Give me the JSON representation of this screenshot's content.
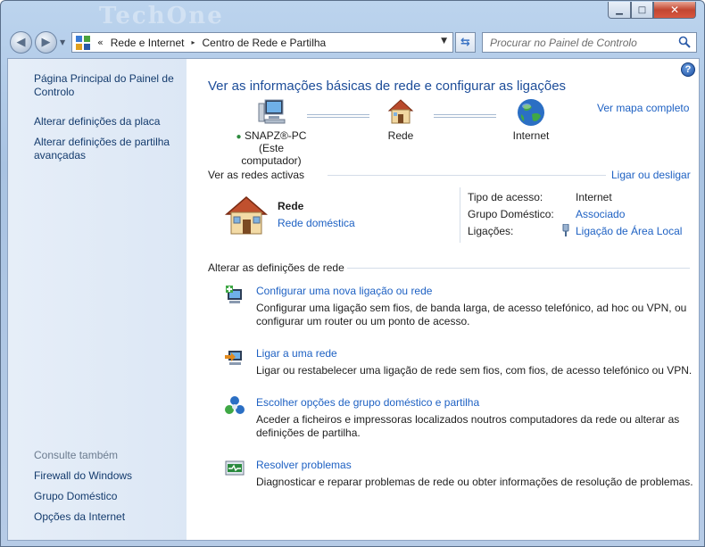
{
  "window": {
    "watermark": "TechOne",
    "controls": {
      "minimize": "▁",
      "maximize": "□",
      "close": "✕"
    }
  },
  "navbar": {
    "back_glyph": "◀",
    "forward_glyph": "▶",
    "chevron": "«",
    "breadcrumbs": [
      "Rede e Internet",
      "Centro de Rede e Partilha"
    ],
    "breadcrumb_separator": "▸",
    "search_placeholder": "Procurar no Painel de Controlo"
  },
  "sidebar": {
    "items": [
      {
        "label": "Página Principal do Painel de Controlo"
      },
      {
        "label": "Alterar definições da placa"
      },
      {
        "label": "Alterar definições de partilha avançadas"
      }
    ],
    "see_also_heading": "Consulte também",
    "see_also": [
      {
        "label": "Firewall do Windows"
      },
      {
        "label": "Grupo Doméstico"
      },
      {
        "label": "Opções da Internet"
      }
    ]
  },
  "main": {
    "help": "?",
    "title": "Ver as informações básicas de rede e configurar as ligações",
    "map_link": "Ver mapa completo",
    "network_map": {
      "computer_name": "SNAPZ®-PC",
      "computer_sub": "(Este computador)",
      "network": "Rede",
      "internet": "Internet"
    },
    "active_networks": {
      "heading": "Ver as redes activas",
      "action_link": "Ligar ou desligar",
      "name": "Rede",
      "type_link": "Rede doméstica",
      "properties": [
        {
          "label": "Tipo de acesso:",
          "value": "Internet",
          "is_link": false
        },
        {
          "label": "Grupo Doméstico:",
          "value": "Associado",
          "is_link": true
        },
        {
          "label": "Ligações:",
          "value": "Ligação de Área Local",
          "is_link": true
        }
      ]
    },
    "change_settings": {
      "heading": "Alterar as definições de rede",
      "tasks": [
        {
          "title": "Configurar uma nova ligação ou rede",
          "description": "Configurar uma ligação sem fios, de banda larga, de acesso telefónico, ad hoc ou VPN, ou configurar um router ou um ponto de acesso.",
          "icon": "new-connection-icon"
        },
        {
          "title": "Ligar a uma rede",
          "description": "Ligar ou restabelecer uma ligação de rede sem fios, com fios, de acesso telefónico ou VPN.",
          "icon": "connect-network-icon"
        },
        {
          "title": "Escolher opções de grupo doméstico e partilha",
          "description": "Aceder a ficheiros e impressoras localizados noutros computadores da rede ou alterar as definições de partilha.",
          "icon": "homegroup-icon"
        },
        {
          "title": "Resolver problemas",
          "description": "Diagnosticar e reparar problemas de rede ou obter informações de resolução de problemas.",
          "icon": "troubleshoot-icon"
        }
      ]
    }
  },
  "colors": {
    "link": "#1e61c3",
    "title": "#1d4d99",
    "sidebar_link": "#143b6d",
    "sidebar_bg": "#e3ecf7"
  }
}
